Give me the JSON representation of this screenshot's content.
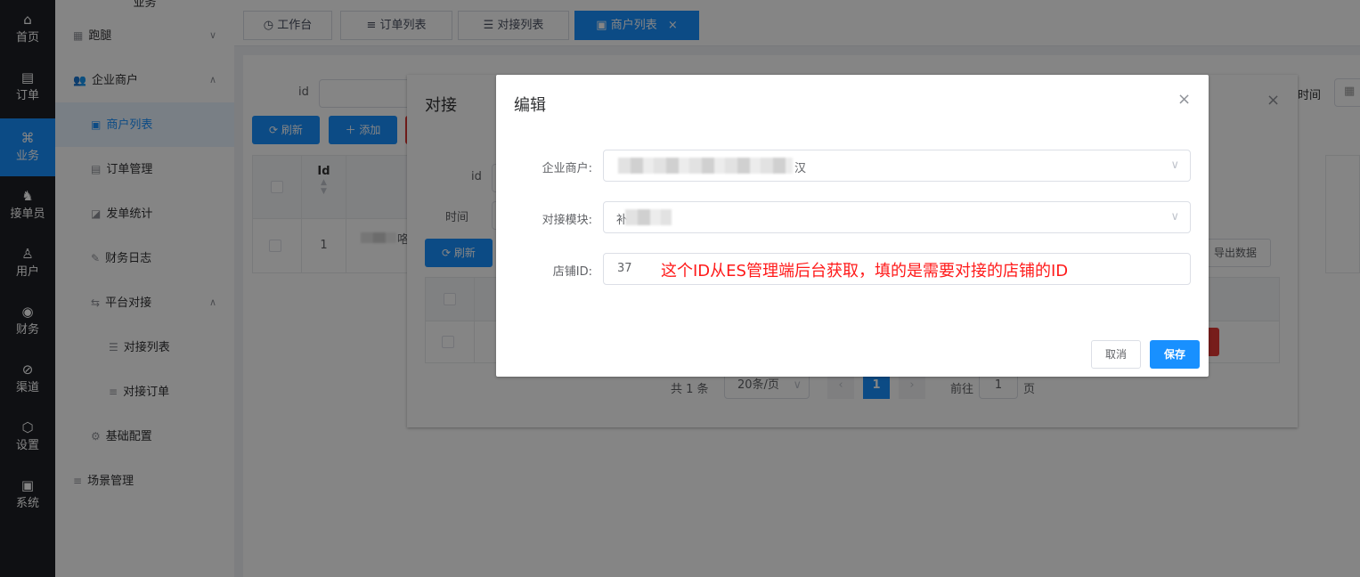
{
  "rail": [
    {
      "label": "首页",
      "icon": "home-icon",
      "glyph": "⌂"
    },
    {
      "label": "订单",
      "icon": "order-icon",
      "glyph": "▤"
    },
    {
      "label": "业务",
      "icon": "business-icon",
      "glyph": "⌘",
      "active": true
    },
    {
      "label": "接单员",
      "icon": "rider-icon",
      "glyph": "♞"
    },
    {
      "label": "用户",
      "icon": "user-icon",
      "glyph": "♙"
    },
    {
      "label": "财务",
      "icon": "finance-icon",
      "glyph": "◉"
    },
    {
      "label": "渠道",
      "icon": "channel-icon",
      "glyph": "⊘"
    },
    {
      "label": "设置",
      "icon": "settings-icon",
      "glyph": "⬡"
    },
    {
      "label": "系统",
      "icon": "system-icon",
      "glyph": "▣"
    }
  ],
  "sidebar": {
    "section_title": "业务",
    "items": [
      {
        "label": "跑腿",
        "icon": "errand-icon",
        "chev": "∨"
      },
      {
        "label": "企业商户",
        "icon": "users-icon",
        "chev": "∧"
      },
      {
        "label": "商户列表",
        "icon": "contact-card-icon",
        "active": true
      },
      {
        "label": "订单管理",
        "icon": "document-icon"
      },
      {
        "label": "发单统计",
        "icon": "chart-icon"
      },
      {
        "label": "财务日志",
        "icon": "edit-log-icon"
      },
      {
        "label": "平台对接",
        "icon": "swap-icon",
        "chev": "∧"
      },
      {
        "label": "对接列表",
        "icon": "list-icon"
      },
      {
        "label": "对接订单",
        "icon": "lines-icon"
      },
      {
        "label": "基础配置",
        "icon": "gear-icon"
      },
      {
        "label": "场景管理",
        "icon": "lines-icon"
      }
    ]
  },
  "tabs": [
    {
      "label": "工作台",
      "icon": "dashboard-icon"
    },
    {
      "label": "订单列表",
      "icon": "lines-icon"
    },
    {
      "label": "对接列表",
      "icon": "list-icon"
    },
    {
      "label": "商户列表",
      "icon": "contact-card-icon",
      "active": true,
      "close": "×"
    }
  ],
  "page": {
    "filter_id_label": "id",
    "refresh": "刷新",
    "add": "添加",
    "col_id": "Id",
    "row_id": "1",
    "row_name_tail": "咯",
    "time_label": "时间"
  },
  "dock_dialog": {
    "title": "对接",
    "id_label": "id",
    "time_label": "时间",
    "refresh": "刷新",
    "export": "导出数据",
    "total": "共 1 条",
    "page_size": "20条/页",
    "current_page": "1",
    "goto": "前往",
    "goto_value": "1",
    "page_unit": "页"
  },
  "edit_dialog": {
    "title": "编辑",
    "merchant_label": "企业商户:",
    "merchant_value_tail": "汉",
    "module_label": "对接模块:",
    "module_value_head": "补",
    "store_label": "店铺ID:",
    "store_value": "37",
    "annotation": "这个ID从ES管理端后台获取，填的是需要对接的店铺的ID",
    "cancel": "取消",
    "save": "保存"
  },
  "colors": {
    "primary": "#1890ff",
    "annotation": "#ff1a1a",
    "danger": "#e53935"
  }
}
